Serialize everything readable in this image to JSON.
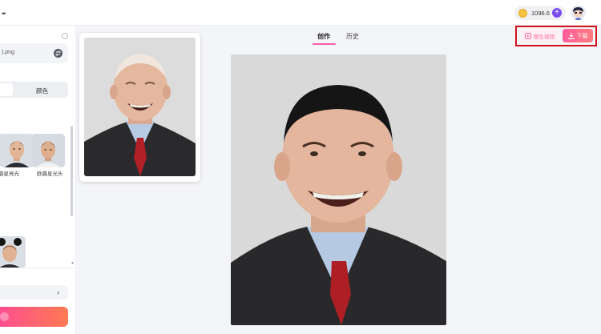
{
  "topbar": {
    "coins": "1096.6",
    "plus_label": "+"
  },
  "left_panel": {
    "file_name": ").png",
    "segment_option": "颜色",
    "styles": [
      {
        "label": "晨星亮光"
      },
      {
        "label": "欧晨星光头"
      }
    ]
  },
  "tabs": [
    {
      "label": "创作"
    },
    {
      "label": "历史"
    }
  ],
  "actions": {
    "generate_video_label": "图生视频",
    "download_label": "下载"
  },
  "colors": {
    "accent_pink": "#ff5ea6",
    "coin": "#f6c141",
    "plus": "#7a4cf0",
    "highlight_box": "#d0121b"
  }
}
